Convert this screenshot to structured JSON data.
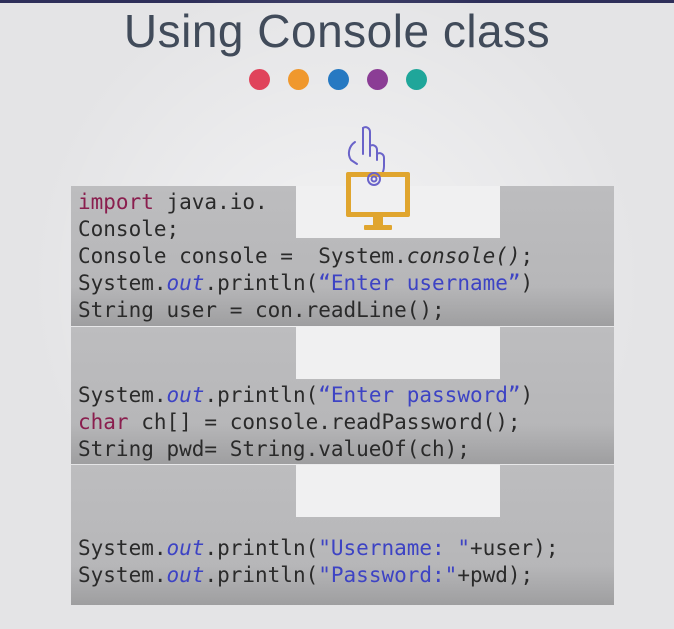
{
  "slide": {
    "title": "Using Console class",
    "dot_colors": [
      "#e0435b",
      "#f0982d",
      "#2679c2",
      "#8b3d95",
      "#1fa69a"
    ]
  },
  "icons": [
    "hand-pointer-icon",
    "monitor-icon"
  ],
  "code": {
    "block1": {
      "line1_kw": "import",
      "line1_rest": " java.io.",
      "line2": "Console;",
      "line3_a": "Console console =  System.",
      "line3_b": "console()",
      "line3_c": ";",
      "line4_a": "System.",
      "line4_b": "out",
      "line4_c": ".println(",
      "line4_d": "“Enter username”",
      "line4_e": ")",
      "line5": "String user = con.readLine();"
    },
    "block2": {
      "line1_a": "System.",
      "line1_b": "out",
      "line1_c": ".println(",
      "line1_d": "“Enter password”",
      "line1_e": ")",
      "line2_kw": "char",
      "line2_rest": " ch[] = console.readPassword();",
      "line3": "String pwd= String.valueOf(ch);"
    },
    "block3": {
      "line1_a": "System.",
      "line1_b": "out",
      "line1_c": ".println(",
      "line1_d": "\"Username: \"",
      "line1_e": "+user);",
      "line2_a": "System.",
      "line2_b": "out",
      "line2_c": ".println(",
      "line2_d": "\"Password:\"",
      "line2_e": "+pwd);"
    }
  }
}
